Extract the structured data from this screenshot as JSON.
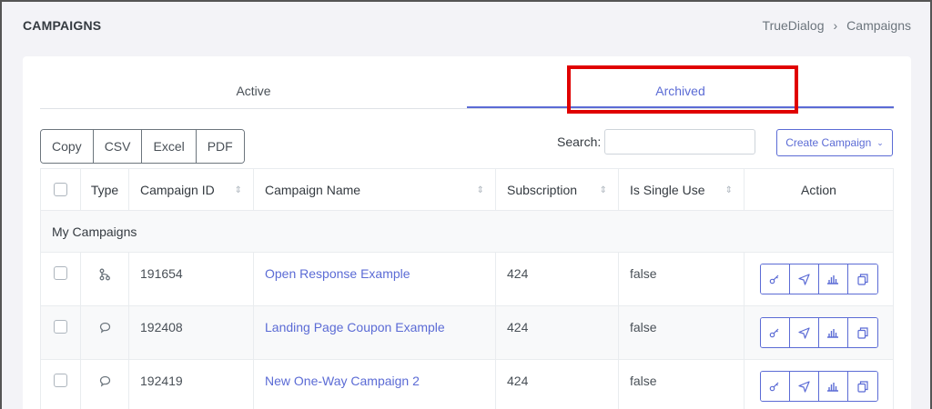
{
  "header": {
    "title": "CAMPAIGNS",
    "breadcrumb": [
      "TrueDialog",
      "Campaigns"
    ],
    "breadcrumb_sep": "›"
  },
  "tabs": [
    {
      "label": "Active",
      "active": false
    },
    {
      "label": "Archived",
      "active": true
    }
  ],
  "toolbar": {
    "export_buttons": [
      "Copy",
      "CSV",
      "Excel",
      "PDF"
    ],
    "search_label": "Search:",
    "search_value": "",
    "create_label": "Create Campaign",
    "create_caret": "⌄"
  },
  "table": {
    "columns": [
      "Type",
      "Campaign ID",
      "Campaign Name",
      "Subscription",
      "Is Single Use",
      "Action"
    ],
    "group_label": "My Campaigns",
    "rows": [
      {
        "type_icon": "branch-icon",
        "id": "191654",
        "name": "Open Response Example",
        "subscription": "424",
        "single_use": "false"
      },
      {
        "type_icon": "chat-bubble-icon",
        "id": "192408",
        "name": "Landing Page Coupon Example",
        "subscription": "424",
        "single_use": "false"
      },
      {
        "type_icon": "chat-bubble-icon",
        "id": "192419",
        "name": "New One-Way Campaign 2",
        "subscription": "424",
        "single_use": "false"
      }
    ],
    "action_icons": [
      "key-icon",
      "send-icon",
      "chart-icon",
      "copy-icon"
    ]
  },
  "colors": {
    "accent": "#5b6bd5",
    "highlight": "#e00000"
  }
}
